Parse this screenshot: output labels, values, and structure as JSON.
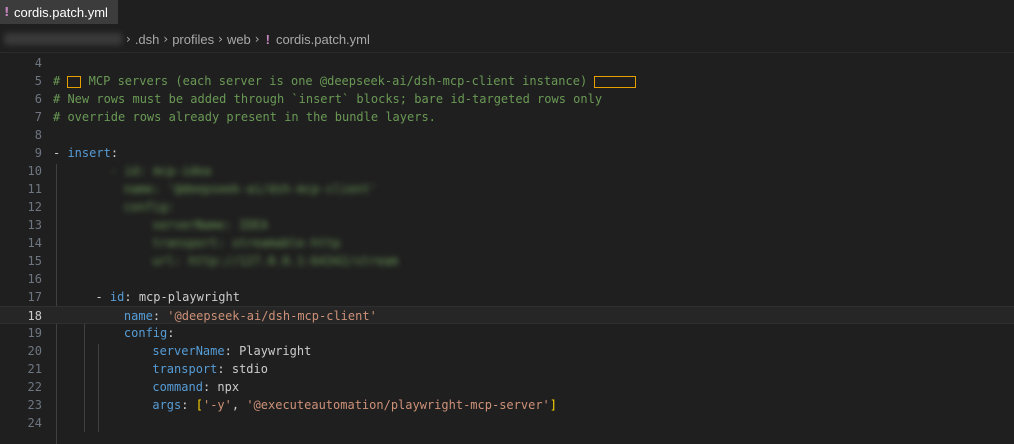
{
  "tab": {
    "icon": "!",
    "title": "cordis.patch.yml"
  },
  "breadcrumb": {
    "parts": [
      ".dsh",
      "profiles",
      "web"
    ],
    "file_icon": "!",
    "file": "cordis.patch.yml"
  },
  "editor": {
    "lines": [
      {
        "n": "4"
      },
      {
        "n": "5",
        "t": "# ",
        "b1": "",
        "t2": " MCP servers (each server is one @deepseek-ai/dsh-mcp-client instance) ",
        "b2": ""
      },
      {
        "n": "6",
        "t": "# New rows must be added through `insert` blocks; bare id-targeted rows only"
      },
      {
        "n": "7",
        "t": "# override rows already present in the bundle layers."
      },
      {
        "n": "8"
      },
      {
        "n": "9",
        "dash": "- ",
        "key": "insert",
        ":": ":"
      },
      {
        "n": "10",
        "blur": "- id: mcp-idea"
      },
      {
        "n": "11",
        "blur": "name: '@deepseek-ai/dsh-mcp-client'"
      },
      {
        "n": "12",
        "blur": "config:"
      },
      {
        "n": "13",
        "blur": "serverName: IDEA"
      },
      {
        "n": "14",
        "blur": "transport: streamable-http"
      },
      {
        "n": "15",
        "blur": "url: http://127.0.0.1:64342/stream"
      },
      {
        "n": "16"
      },
      {
        "n": "17",
        "dash": "- ",
        "key": "id",
        "val": "mcp-playwright"
      },
      {
        "n": "18",
        "key": "name",
        "str": "'@deepseek-ai/dsh-mcp-client'"
      },
      {
        "n": "19",
        "key": "config"
      },
      {
        "n": "20",
        "key": "serverName",
        "val": "Playwright"
      },
      {
        "n": "21",
        "key": "transport",
        "val": "stdio"
      },
      {
        "n": "22",
        "key": "command",
        "val": "npx"
      },
      {
        "n": "23",
        "key": "args",
        "arr": [
          "'-y'",
          "'@executeautomation/playwright-mcp-server'"
        ]
      },
      {
        "n": "24"
      }
    ]
  }
}
